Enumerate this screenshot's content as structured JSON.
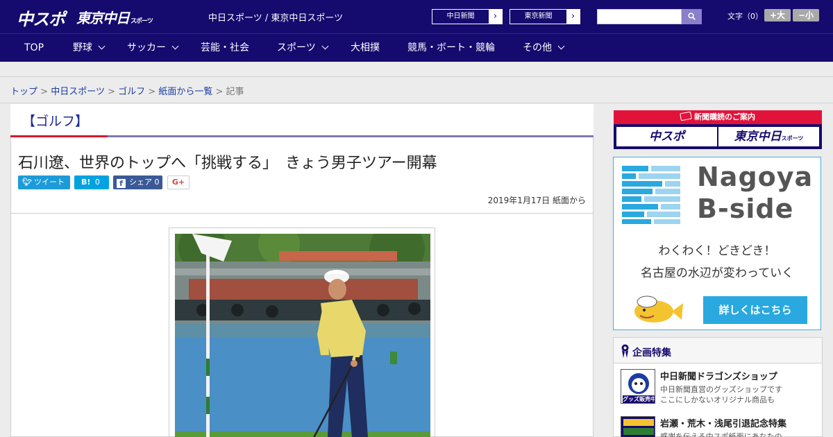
{
  "header": {
    "logo_chuspo": "中スポ",
    "logo_tokyo": "東京中日",
    "logo_tokyo_suffix": "スポーツ",
    "site_desc": "中日スポーツ / 東京中日スポーツ",
    "paper_links": [
      "中日新聞",
      "東京新聞"
    ],
    "search": {
      "placeholder": "",
      "value": ""
    },
    "fontsize_label": "文字（0）",
    "fontsize_plus": "+大",
    "fontsize_minus": "−小"
  },
  "nav": {
    "items": [
      {
        "label": "TOP"
      },
      {
        "label": "野球"
      },
      {
        "label": "サッカー"
      },
      {
        "label": "芸能・社会"
      },
      {
        "label": "スポーツ"
      },
      {
        "label": "大相撲"
      },
      {
        "label": "競馬・ボート・競輪"
      },
      {
        "label": "その他"
      }
    ]
  },
  "breadcrumb": {
    "items": [
      "トップ",
      "中日スポーツ",
      "ゴルフ",
      "紙面から一覧"
    ],
    "current": "記事",
    "separator": ">"
  },
  "article": {
    "category": "【ゴルフ】",
    "headline": "石川遼、世界のトップへ「挑戦する」　きょう男子ツアー開幕",
    "share": {
      "tweet": "ツイート",
      "hatena_icon": "B!",
      "hatena_count": "0",
      "facebook_icon": "f",
      "facebook_label": "シェア",
      "facebook_count": "0",
      "gplus": "G+"
    },
    "dateline": "2019年1月17日 紙面から"
  },
  "sidebar": {
    "subscribe": {
      "title": "新聞購読のご案内",
      "btn1": "中スポ",
      "btn2": "東京中日",
      "btn2_suffix": "スポーツ"
    },
    "bside": {
      "word1": "Nagoya",
      "word2": "B-side",
      "tag1": "わくわく！どきどき！",
      "tag2": "名古屋の水辺が変わっていく",
      "cta": "詳しくはこちら"
    },
    "feature": {
      "title": "企画特集",
      "items": [
        {
          "title": "中日新聞ドラゴンズショップ",
          "desc1": "中日新聞直営のグッズショップです",
          "desc2": "ここにしかないオリジナル商品も",
          "thumb_text": "グッズ販売中"
        },
        {
          "title": "岩瀬・荒木・浅尾引退記念特集",
          "desc1": "感謝を伝える中スポ紙面にあなたの"
        }
      ]
    }
  },
  "colors": {
    "brand_navy": "#150a6e",
    "accent_red": "#d41a2c",
    "link_blue": "#1a3ca3",
    "twitter": "#1d9bd8",
    "facebook": "#3b5998",
    "bside_blue": "#2aa8e0"
  }
}
